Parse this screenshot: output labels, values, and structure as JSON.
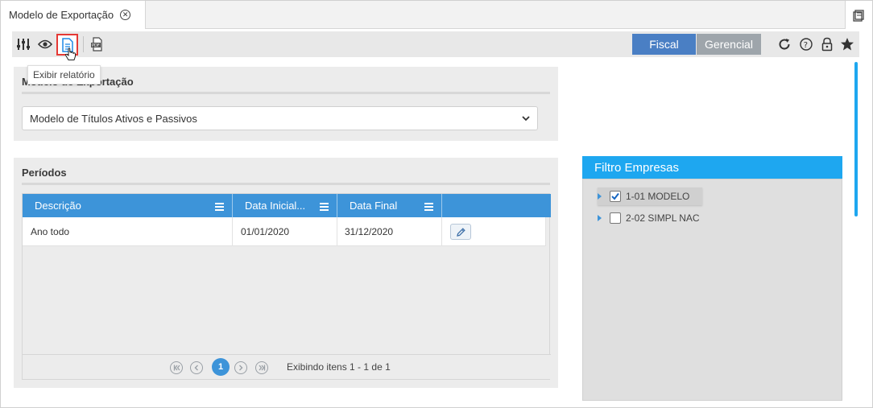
{
  "tab": {
    "title": "Modelo de Exportação"
  },
  "toolbar": {
    "tooltip": "Exibir relatório",
    "segments": [
      "Fiscal",
      "Gerencial"
    ],
    "icons": [
      "sliders-icon",
      "eye-icon",
      "report-icon",
      "pdf-export-icon",
      "refresh-icon",
      "help-icon",
      "lock-icon",
      "star-icon"
    ]
  },
  "model_panel": {
    "title": "Modelo de Exportação",
    "select_value": "Modelo de Títulos Ativos e Passivos"
  },
  "periods_panel": {
    "title": "Períodos",
    "columns": [
      "Descrição",
      "Data Inicial...",
      "Data Final"
    ],
    "rows": [
      {
        "descricao": "Ano todo",
        "data_inicial": "01/01/2020",
        "data_final": "31/12/2020"
      }
    ],
    "pager": {
      "current_page": "1",
      "info": "Exibindo itens 1 - 1 de 1"
    }
  },
  "filter_panel": {
    "title": "Filtro Empresas",
    "items": [
      {
        "label": "1-01 MODELO",
        "checked": true
      },
      {
        "label": "2-02 SIMPL NAC",
        "checked": false
      }
    ]
  },
  "colors": {
    "primary": "#3d94d9",
    "accent": "#1ea7f0",
    "fiscal": "#4a7fc4",
    "gerencial": "#9ea5ab",
    "highlight": "#e53935"
  }
}
